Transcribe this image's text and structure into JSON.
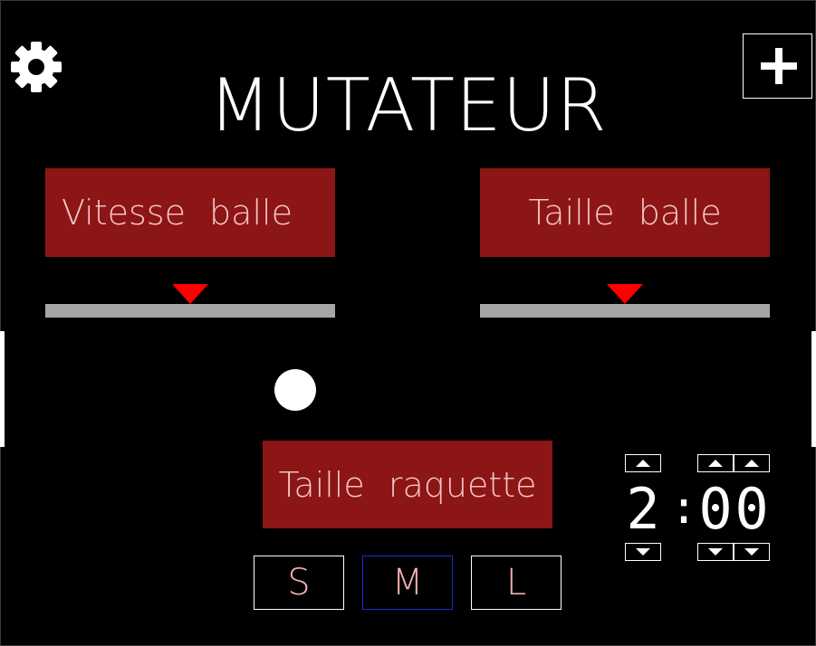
{
  "title": "MUTATEUR",
  "settings": {
    "icon": "gear-icon"
  },
  "add": {
    "icon": "plus-icon"
  },
  "speed": {
    "label": "Vitesse balle",
    "value": 0.5
  },
  "size": {
    "label": "Taille balle",
    "value": 0.5
  },
  "racket": {
    "label": "Taille raquette",
    "options": [
      "S",
      "M",
      "L"
    ],
    "selected": "M"
  },
  "timer": {
    "minutes": "2",
    "colon": ":",
    "tens": "0",
    "units": "0"
  },
  "colors": {
    "accent_red": "#8c1515",
    "slider_thumb": "#ff0000",
    "selected_border": "#1a2bd6"
  }
}
